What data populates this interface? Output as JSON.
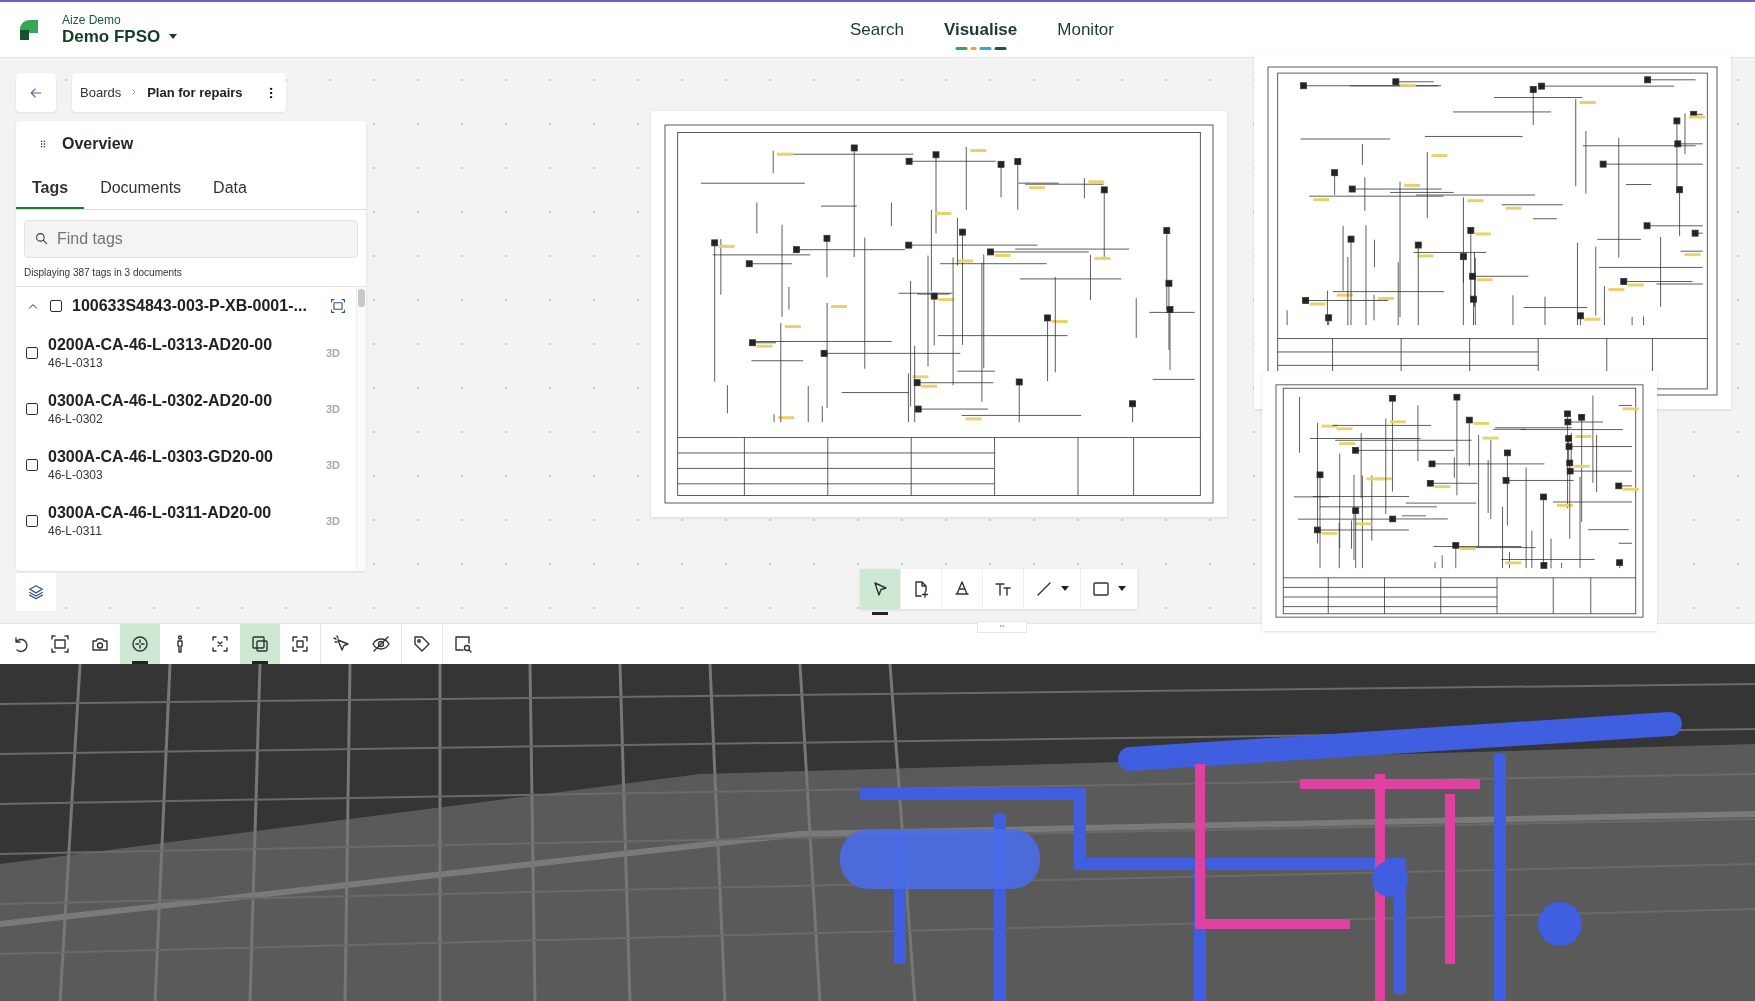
{
  "header": {
    "organization": "Aize Demo",
    "project": "Demo FPSO",
    "nav": [
      {
        "label": "Search",
        "selected": false
      },
      {
        "label": "Visualise",
        "selected": true
      },
      {
        "label": "Monitor",
        "selected": false
      }
    ]
  },
  "breadcrumb": [
    "Boards",
    "Plan for repairs"
  ],
  "panel": {
    "title": "Overview",
    "tabs": [
      {
        "label": "Tags",
        "selected": true
      },
      {
        "label": "Documents",
        "selected": false
      },
      {
        "label": "Data",
        "selected": false
      }
    ],
    "search": {
      "placeholder": "Find tags"
    },
    "summary": "Displaying 387 tags in 3 documents",
    "documents": [
      {
        "name": "100633S4843-003-P-XB-0001-...",
        "expanded": true,
        "checked": false,
        "tags": [
          {
            "name": "0200A-CA-46-L-0313-AD20-00",
            "code": "46-L-0313",
            "badge": "3D",
            "checked": false
          },
          {
            "name": "0300A-CA-46-L-0302-AD20-00",
            "code": "46-L-0302",
            "badge": "3D",
            "checked": false
          },
          {
            "name": "0300A-CA-46-L-0303-GD20-00",
            "code": "46-L-0303",
            "badge": "3D",
            "checked": false
          },
          {
            "name": "0300A-CA-46-L-0311-AD20-00",
            "code": "46-L-0311",
            "badge": "3D",
            "checked": false
          }
        ]
      }
    ]
  },
  "drawing_tools": [
    {
      "kind": "select",
      "selected": true
    },
    {
      "kind": "add-document",
      "selected": false
    },
    {
      "kind": "pen",
      "selected": false
    },
    {
      "kind": "text",
      "selected": false
    },
    {
      "kind": "line",
      "selected": false
    },
    {
      "kind": "rectangle",
      "selected": false
    }
  ],
  "viewer_tools": [
    {
      "kind": "reset",
      "selected": false
    },
    {
      "kind": "fit",
      "selected": false
    },
    {
      "kind": "camera",
      "selected": false
    },
    {
      "kind": "orbit",
      "selected": true
    },
    {
      "kind": "walk",
      "selected": false
    },
    {
      "kind": "focus",
      "selected": false
    },
    {
      "kind": "isolate",
      "selected": true
    },
    {
      "kind": "frame",
      "selected": false
    },
    {
      "kind": "pick",
      "selected": false
    },
    {
      "kind": "hide",
      "selected": false
    },
    {
      "kind": "tag",
      "selected": false
    },
    {
      "kind": "search-area",
      "selected": false
    }
  ]
}
